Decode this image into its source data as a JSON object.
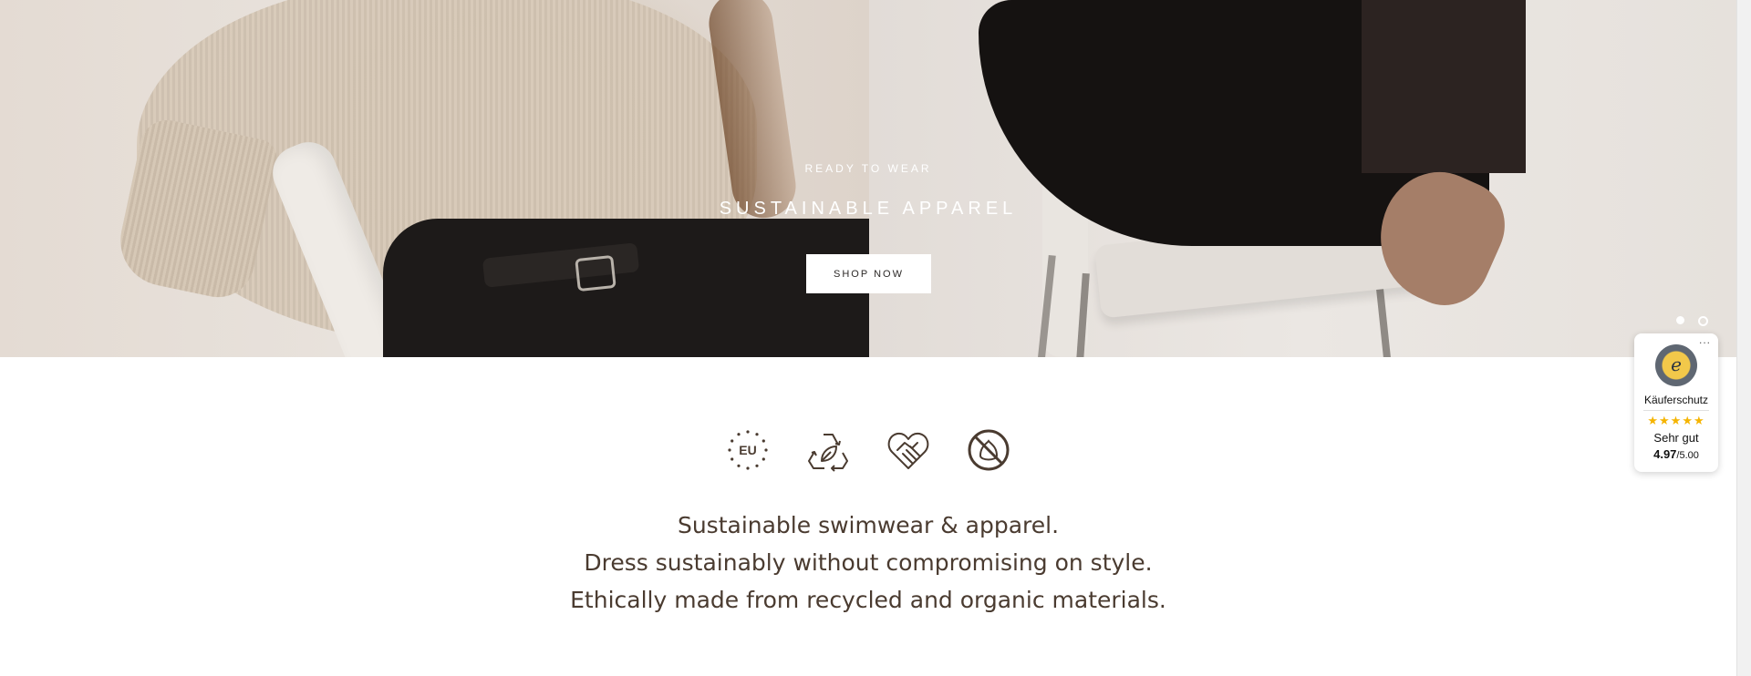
{
  "hero": {
    "eyebrow": "READY TO WEAR",
    "title": "SUSTAINABLE APPAREL",
    "cta_label": "SHOP NOW",
    "slides": 2,
    "active_slide": 1
  },
  "icons": [
    {
      "name": "eu-icon",
      "text": "EU"
    },
    {
      "name": "recycle-leaf-icon"
    },
    {
      "name": "heart-handshake-icon"
    },
    {
      "name": "no-plastic-icon"
    }
  ],
  "tagline": {
    "line1": "Sustainable swimwear & apparel.",
    "line2": "Dress sustainably without compromising on style.",
    "line3": "Ethically made from recycled and organic materials."
  },
  "trust_badge": {
    "more": "...",
    "seal_letter": "e",
    "label": "Käuferschutz",
    "stars": "★★★★★",
    "rating": "Sehr gut",
    "score": "4.97",
    "max": "/5.00"
  },
  "colors": {
    "text_brown": "#4a3b30",
    "star": "#f5b400",
    "button_bg": "#ffffff"
  }
}
